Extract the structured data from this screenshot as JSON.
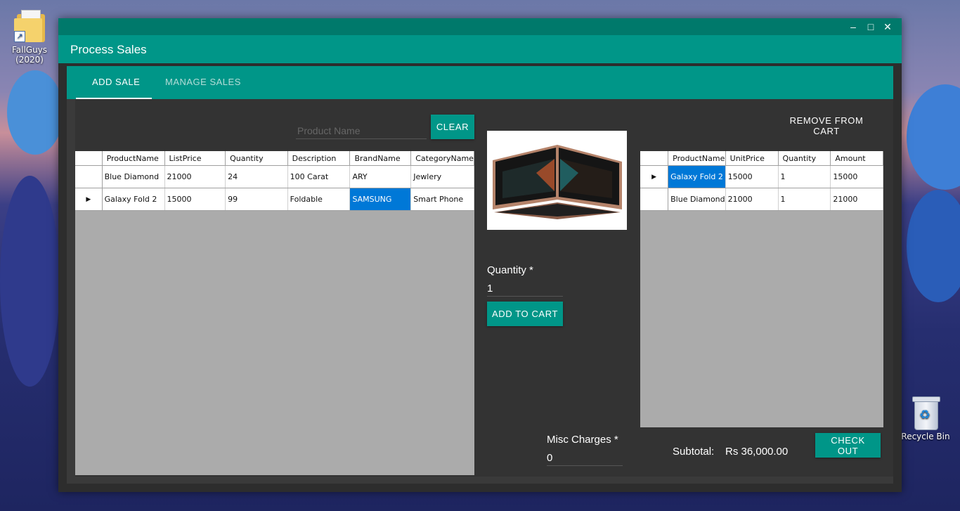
{
  "desktop": {
    "icons": [
      {
        "label": "FallGuys (2020)"
      },
      {
        "label": "Recycle Bin"
      }
    ]
  },
  "window": {
    "title": "Process Sales",
    "controls": {
      "minimize": "–",
      "maximize": "□",
      "close": "✕"
    }
  },
  "tabs": [
    {
      "label": "ADD SALE",
      "active": true
    },
    {
      "label": "MANAGE SALES",
      "active": false
    }
  ],
  "search": {
    "placeholder": "Product Name",
    "value": ""
  },
  "buttons": {
    "clear": "CLEAR",
    "remove_from_cart": "REMOVE FROM CART",
    "add_to_cart": "ADD TO CART",
    "check_out": "CHECK OUT"
  },
  "products": {
    "columns": [
      "ProductName",
      "ListPrice",
      "Quantity",
      "Description",
      "BrandName",
      "CategoryName"
    ],
    "rows": [
      [
        "Blue Diamond",
        "21000",
        "24",
        "100 Carat",
        "ARY",
        "Jewlery"
      ],
      [
        "Galaxy Fold 2",
        "15000",
        "99",
        "Foldable",
        "SAMSUNG",
        "Smart Phone"
      ]
    ],
    "current_row": 1,
    "selected_cell": "SAMSUNG"
  },
  "cart": {
    "columns": [
      "ProductName",
      "UnitPrice",
      "Quantity",
      "Amount"
    ],
    "rows": [
      [
        "Galaxy Fold 2",
        "15000",
        "1",
        "15000"
      ],
      [
        "Blue Diamond",
        "21000",
        "1",
        "21000"
      ]
    ],
    "current_row": 0,
    "selected_cell": "Galaxy Fold 2"
  },
  "quantity": {
    "label": "Quantity *",
    "value": "1"
  },
  "misc_charges": {
    "label": "Misc Charges *",
    "value": "0"
  },
  "subtotal": {
    "label": "Subtotal:",
    "value": "Rs 36,000.00"
  },
  "colors": {
    "accent": "#009688",
    "accent_dark": "#00796b",
    "selection": "#0078d7",
    "panel": "#333333"
  }
}
